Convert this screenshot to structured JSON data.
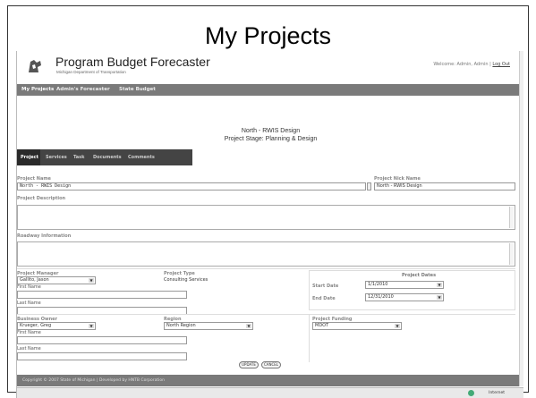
{
  "slide": {
    "title": "My Projects"
  },
  "app": {
    "title": "Program Budget Forecaster",
    "subtitle": "Michigan Department of Transportation",
    "welcome_text": "Welcome: Admin, Admin |",
    "logout": "Log Out"
  },
  "nav": {
    "items": [
      {
        "label": "My Projects"
      },
      {
        "label": "Admin's Forecaster"
      },
      {
        "label": "State Budget"
      }
    ]
  },
  "project_header": {
    "name": "North - RWIS Design",
    "stage": "Project Stage: Planning & Design"
  },
  "tabs": [
    {
      "label": "Project"
    },
    {
      "label": "Services"
    },
    {
      "label": "Task"
    },
    {
      "label": "Documents"
    },
    {
      "label": "Comments"
    }
  ],
  "form": {
    "project_name_label": "Project Name",
    "project_name_value": "North - RWIS Design",
    "nick_name_label": "Project Nick Name",
    "nick_name_value": "North - RWIS Design",
    "description_label": "Project Description",
    "roadway_label": "Roadway Information",
    "manager_label": "Project Manager",
    "manager_value": "Gallito, Jason",
    "first_name_label": "First Name",
    "last_name_label": "Last Name",
    "project_type_label": "Project Type",
    "project_type_value": "Consulting Services",
    "project_dates_label": "Project Dates",
    "start_date_label": "Start Date",
    "start_date_value": "1/1/2010",
    "end_date_label": "End Date",
    "end_date_value": "12/31/2010",
    "owner_label": "Business Owner",
    "owner_value": "Krueger, Greg",
    "owner_first_name_label": "First Name",
    "owner_last_name_label": "Last Name",
    "region_label": "Region",
    "region_value": "North Region",
    "funding_label": "Project Funding",
    "funding_value": "MDOT"
  },
  "buttons": {
    "update": "UPDATE",
    "cancel": "CANCEL"
  },
  "footer": {
    "text": "Copyright © 2007 State of Michigan | Developed by HNTB Corporation"
  },
  "statusbar": {
    "zone": "Internet"
  }
}
